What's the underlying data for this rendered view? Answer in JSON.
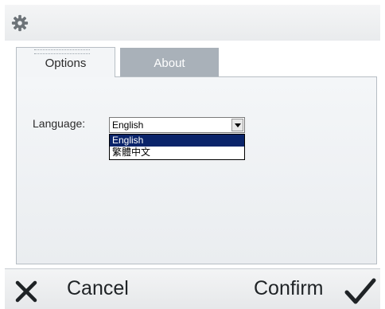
{
  "header": {
    "icon": "gear-icon"
  },
  "tabs": [
    {
      "label": "Options",
      "active": true
    },
    {
      "label": "About",
      "active": false
    }
  ],
  "options": {
    "language_label": "Language:",
    "language_selected": "English",
    "language_options": [
      "English",
      "繁體中文"
    ]
  },
  "footer": {
    "cancel_label": "Cancel",
    "confirm_label": "Confirm",
    "cancel_icon": "close-icon",
    "confirm_icon": "checkmark-icon"
  },
  "colors": {
    "tab_inactive": "#a9b1b9",
    "selection": "#0a246a"
  }
}
